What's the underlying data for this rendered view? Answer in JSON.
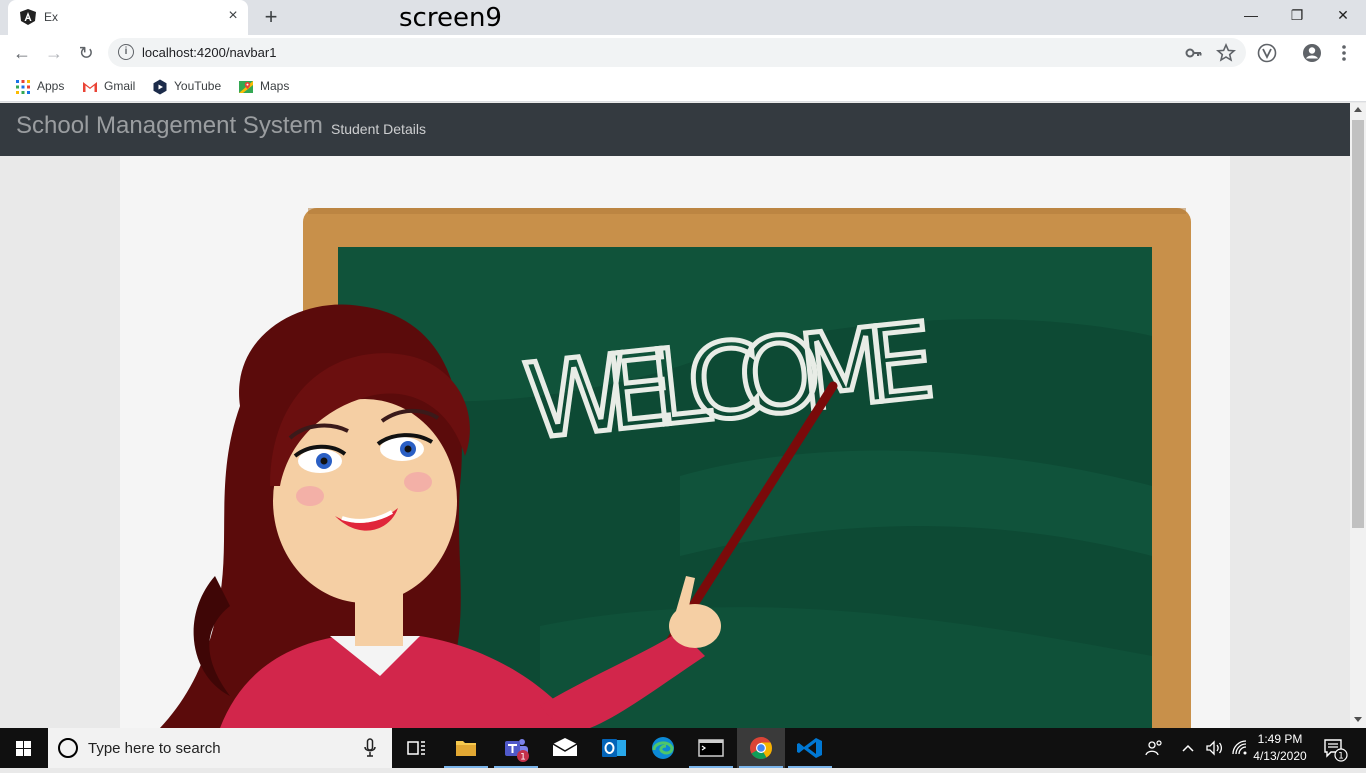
{
  "browser": {
    "tab_title": "Ex",
    "tab_close": "×",
    "new_tab": "+",
    "overlay_caption": "screen9",
    "window_controls": {
      "minimize": "—",
      "restore": "❐",
      "close": "✕"
    },
    "url": "localhost:4200/navbar1",
    "nav": {
      "back": "←",
      "forward": "→",
      "reload": "↻"
    },
    "bookmarks": [
      {
        "label": "Apps",
        "icon": "apps-grid-icon"
      },
      {
        "label": "Gmail",
        "icon": "gmail-icon"
      },
      {
        "label": "YouTube",
        "icon": "youtube-icon"
      },
      {
        "label": "Maps",
        "icon": "maps-icon"
      }
    ]
  },
  "page": {
    "brand": "School Management System",
    "nav_link": "Student Details",
    "hero_text": "WELCOME"
  },
  "taskbar": {
    "search_placeholder": "Type here to search",
    "teams_badge": "1",
    "notification_badge": "1",
    "time": "1:49 PM",
    "date": "4/13/2020"
  },
  "colors": {
    "navbar": "#343a40",
    "chalkboard": "#0d4a34",
    "frame": "#c8904a"
  }
}
